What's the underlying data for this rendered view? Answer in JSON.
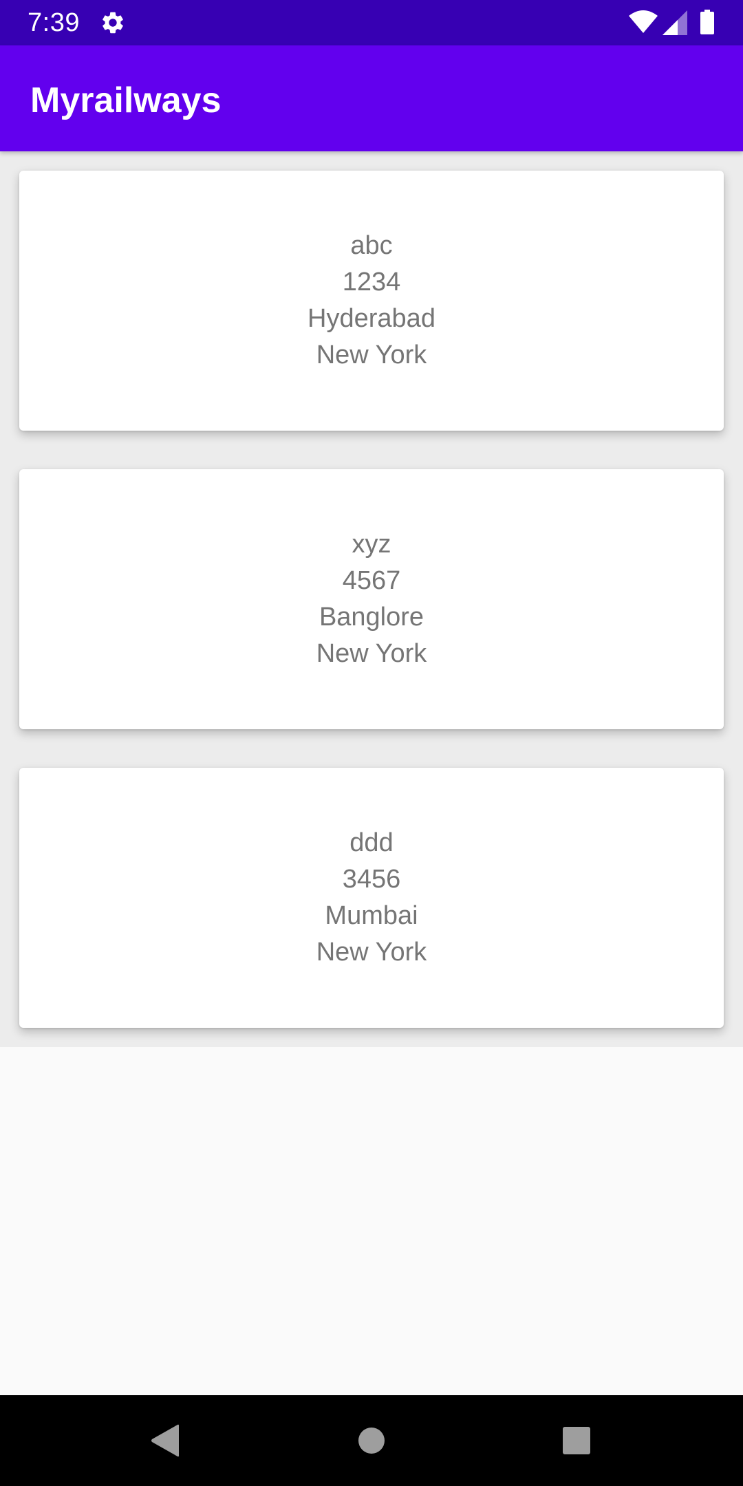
{
  "status_bar": {
    "time": "7:39",
    "icons": [
      "gear-icon",
      "wifi-icon",
      "signal-icon",
      "battery-icon"
    ]
  },
  "app_bar": {
    "title": "Myrailways"
  },
  "colors": {
    "status_bar": "#3700b3",
    "app_bar": "#6200ee",
    "card_text": "#757575",
    "background": "#fafafa"
  },
  "trains": [
    {
      "name": "abc",
      "number": "1234",
      "from": "Hyderabad",
      "to": "New York"
    },
    {
      "name": "xyz",
      "number": "4567",
      "from": "Banglore",
      "to": "New York"
    },
    {
      "name": "ddd",
      "number": "3456",
      "from": "Mumbai",
      "to": "New York"
    }
  ],
  "nav_bar": {
    "icons": [
      "back-icon",
      "home-icon",
      "recents-icon"
    ]
  }
}
